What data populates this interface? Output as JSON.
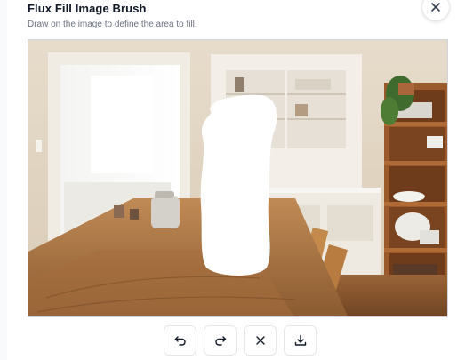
{
  "dialog": {
    "title": "Flux Fill Image Brush",
    "subtitle": "Draw on the image to define the area to fill."
  },
  "icons": {
    "close": "close-icon",
    "undo": "undo-icon",
    "redo": "redo-icon",
    "clear": "clear-icon",
    "download": "download-icon"
  },
  "image": {
    "description_visible": false,
    "mask_color": "#ffffff"
  },
  "colors": {
    "background": "#ffffff",
    "border": "#e5e7eb",
    "text_primary": "#111827",
    "text_secondary": "#6b7280"
  }
}
